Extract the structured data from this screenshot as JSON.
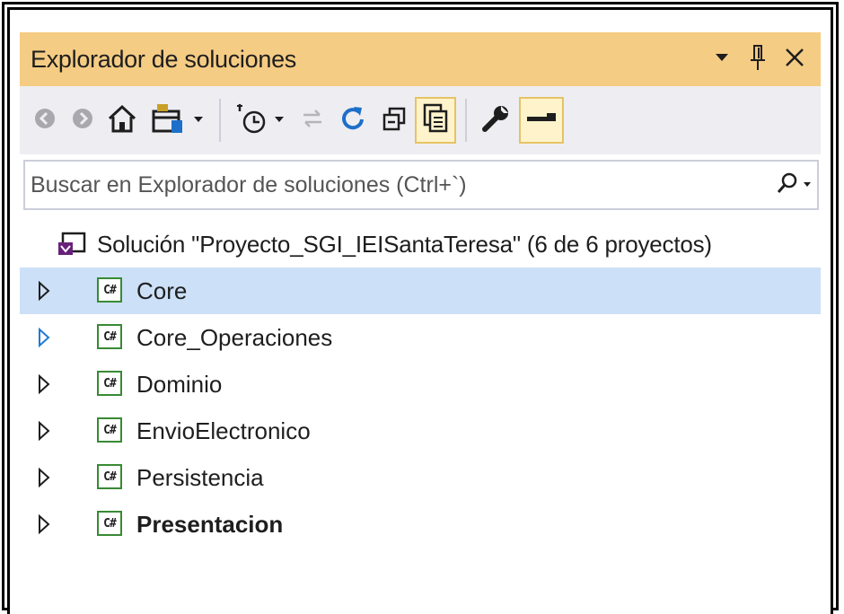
{
  "panel": {
    "title": "Explorador de soluciones",
    "title_buttons": {
      "dropdown_icon": "chevron-down-icon",
      "pin_icon": "pin-icon",
      "close_icon": "close-icon"
    }
  },
  "toolbar": {
    "buttons": [
      {
        "name": "back",
        "icon": "back-arrow-icon",
        "enabled": false
      },
      {
        "name": "forward",
        "icon": "forward-arrow-icon",
        "enabled": false
      },
      {
        "name": "home",
        "icon": "home-icon",
        "enabled": true
      },
      {
        "name": "switch-views",
        "icon": "switch-views-icon",
        "enabled": true
      },
      {
        "name": "pending-changes-filter",
        "icon": "pending-changes-icon",
        "enabled": true
      },
      {
        "name": "sync-with-active-document",
        "icon": "sync-icon",
        "enabled": false
      },
      {
        "name": "refresh",
        "icon": "refresh-icon",
        "enabled": true
      },
      {
        "name": "collapse-all",
        "icon": "collapse-all-icon",
        "enabled": true
      },
      {
        "name": "show-all-files",
        "icon": "show-all-files-icon",
        "active": true
      },
      {
        "name": "properties",
        "icon": "wrench-icon",
        "enabled": true
      },
      {
        "name": "preview-selected-items",
        "icon": "preview-icon",
        "active": true
      }
    ]
  },
  "search": {
    "placeholder": "Buscar en Explorador de soluciones (Ctrl+`)",
    "icon": "search-icon"
  },
  "tree": {
    "solution": {
      "label": "Solución \"Proyecto_SGI_IEISantaTeresa\" (6 de 6 proyectos)",
      "icon": "visual-studio-solution-icon"
    },
    "project_icon_text": "C#",
    "projects": [
      {
        "label": "Core",
        "selected": true,
        "expander_color": "#1e1e1e",
        "bold": false
      },
      {
        "label": "Core_Operaciones",
        "selected": false,
        "expander_color": "#1e7bd6",
        "bold": false
      },
      {
        "label": "Dominio",
        "selected": false,
        "expander_color": "#1e1e1e",
        "bold": false
      },
      {
        "label": "EnvioElectronico",
        "selected": false,
        "expander_color": "#1e1e1e",
        "bold": false
      },
      {
        "label": "Persistencia",
        "selected": false,
        "expander_color": "#1e1e1e",
        "bold": false
      },
      {
        "label": "Presentacion",
        "selected": false,
        "expander_color": "#1e1e1e",
        "bold": true
      }
    ]
  },
  "colors": {
    "title_bar": "#f5cc84",
    "toolbar": "#eeeef2",
    "selection": "#cce0f7",
    "active_button": "#fff3cc",
    "csharp_border": "#388a34"
  }
}
